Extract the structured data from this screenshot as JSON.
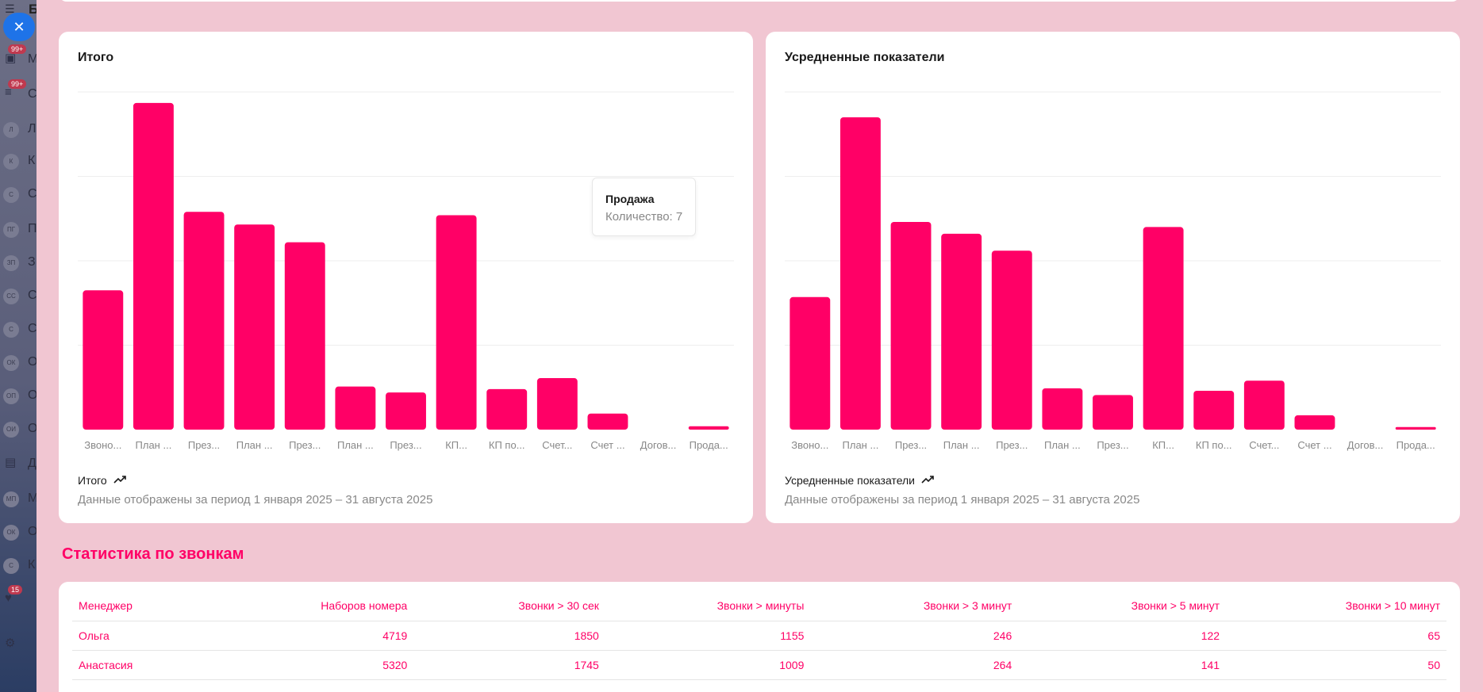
{
  "sidebar": {
    "top_text": "Б",
    "close_icon": "close-icon",
    "items": [
      {
        "avatar": "",
        "letter": "М",
        "badge": "99+",
        "icon": "chat-icon"
      },
      {
        "avatar": "",
        "letter": "С",
        "badge": "99+",
        "icon": "filter-icon"
      },
      {
        "avatar": "Л",
        "letter": "Л"
      },
      {
        "avatar": "К",
        "letter": "К"
      },
      {
        "avatar": "С",
        "letter": "С"
      },
      {
        "avatar": "ПГ",
        "letter": "П"
      },
      {
        "avatar": "ЗП",
        "letter": "З"
      },
      {
        "avatar": "СС",
        "letter": "С"
      },
      {
        "avatar": "С",
        "letter": "С"
      },
      {
        "avatar": "ОК",
        "letter": "О"
      },
      {
        "avatar": "ОП",
        "letter": "О"
      },
      {
        "avatar": "ОИ",
        "letter": "О"
      },
      {
        "avatar": "",
        "letter": "Д",
        "icon": "message-icon"
      },
      {
        "avatar": "МП",
        "letter": "М"
      },
      {
        "avatar": "ОК",
        "letter": "О"
      },
      {
        "avatar": "С",
        "letter": "К"
      },
      {
        "avatar": "",
        "letter": "",
        "badge": "15",
        "icon": "heart-icon"
      },
      {
        "avatar": "",
        "letter": "",
        "icon": "settings-icon"
      }
    ]
  },
  "charts": {
    "total": {
      "title": "Итого",
      "footer_title": "Итого",
      "footer_subtitle": "Данные отображены за период 1 января 2025 – 31 августа 2025",
      "tooltip": {
        "title": "Продажа",
        "value": "Количество: 7"
      }
    },
    "average": {
      "title": "Усредненные показатели",
      "footer_title": "Усредненные показатели",
      "footer_subtitle": "Данные отображены за период 1 января 2025 – 31 августа 2025"
    }
  },
  "chart_data": [
    {
      "type": "bar",
      "title": "Итого",
      "categories": [
        "Звоно...",
        "План ...",
        "През...",
        "План ...",
        "През...",
        "План ...",
        "През...",
        "КП...",
        "КП по...",
        "Счет...",
        "Счет ...",
        "Догов...",
        "Прода..."
      ],
      "values": [
        165,
        387,
        258,
        243,
        222,
        51,
        44,
        254,
        48,
        61,
        19,
        0,
        4
      ],
      "ylim": [
        0,
        400
      ],
      "grid": true,
      "color": "#ff0066"
    },
    {
      "type": "bar",
      "title": "Усредненные показатели",
      "categories": [
        "Звоно...",
        "План ...",
        "През...",
        "План ...",
        "През...",
        "План ...",
        "През...",
        "КП...",
        "КП по...",
        "Счет...",
        "Счет ...",
        "Догов...",
        "Прода..."
      ],
      "values": [
        157,
        370,
        246,
        232,
        212,
        49,
        41,
        240,
        46,
        58,
        17,
        0,
        3
      ],
      "ylim": [
        0,
        400
      ],
      "grid": true,
      "color": "#ff0066"
    }
  ],
  "calls": {
    "title": "Статистика по звонкам",
    "headers": [
      "Менеджер",
      "Наборов номера",
      "Звонки > 30 сек",
      "Звонки > минуты",
      "Звонки > 3 минут",
      "Звонки > 5 минут",
      "Звонки > 10 минут"
    ],
    "rows": [
      [
        "Ольга",
        "4719",
        "1850",
        "1155",
        "246",
        "122",
        "65"
      ],
      [
        "Анастасия",
        "5320",
        "1745",
        "1009",
        "264",
        "141",
        "50"
      ],
      [
        "",
        "",
        "",
        "",
        "",
        "",
        ""
      ]
    ]
  },
  "colors": {
    "accent": "#ff0066",
    "background": "#f1c6d2"
  }
}
